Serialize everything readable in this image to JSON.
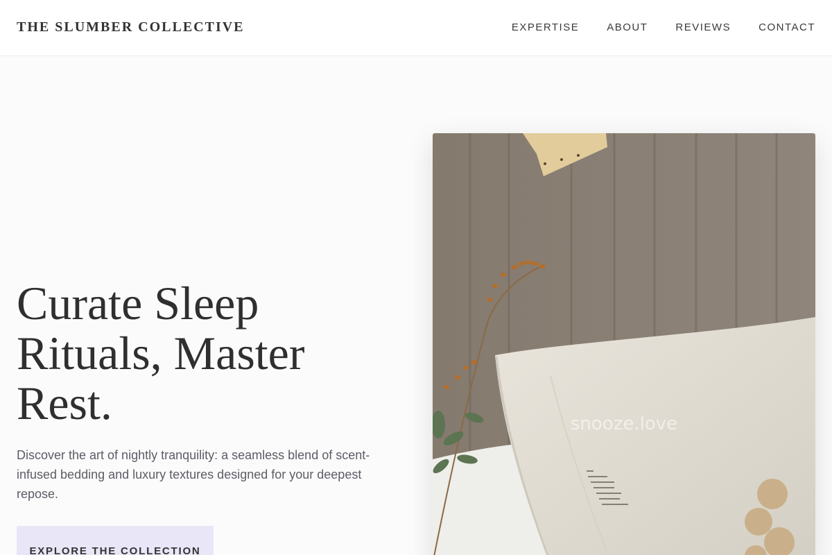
{
  "brand": {
    "name": "THE SLUMBER COLLECTIVE"
  },
  "nav": {
    "items": [
      {
        "label": "EXPERTISE"
      },
      {
        "label": "ABOUT"
      },
      {
        "label": "REVIEWS"
      },
      {
        "label": "CONTACT"
      }
    ]
  },
  "hero": {
    "headline": "Curate Sleep Rituals, Master Rest.",
    "subtext": "Discover the art of nightly tranquility: a seamless blend of scent-infused bedding and luxury textures designed for your deepest repose.",
    "cta_label": "EXPLORE THE COLLECTION",
    "image_watermark": "snooze.love"
  },
  "colors": {
    "background": "#fbfbfb",
    "cta_background": "#e8e6f7",
    "text": "#2f2f2f"
  }
}
